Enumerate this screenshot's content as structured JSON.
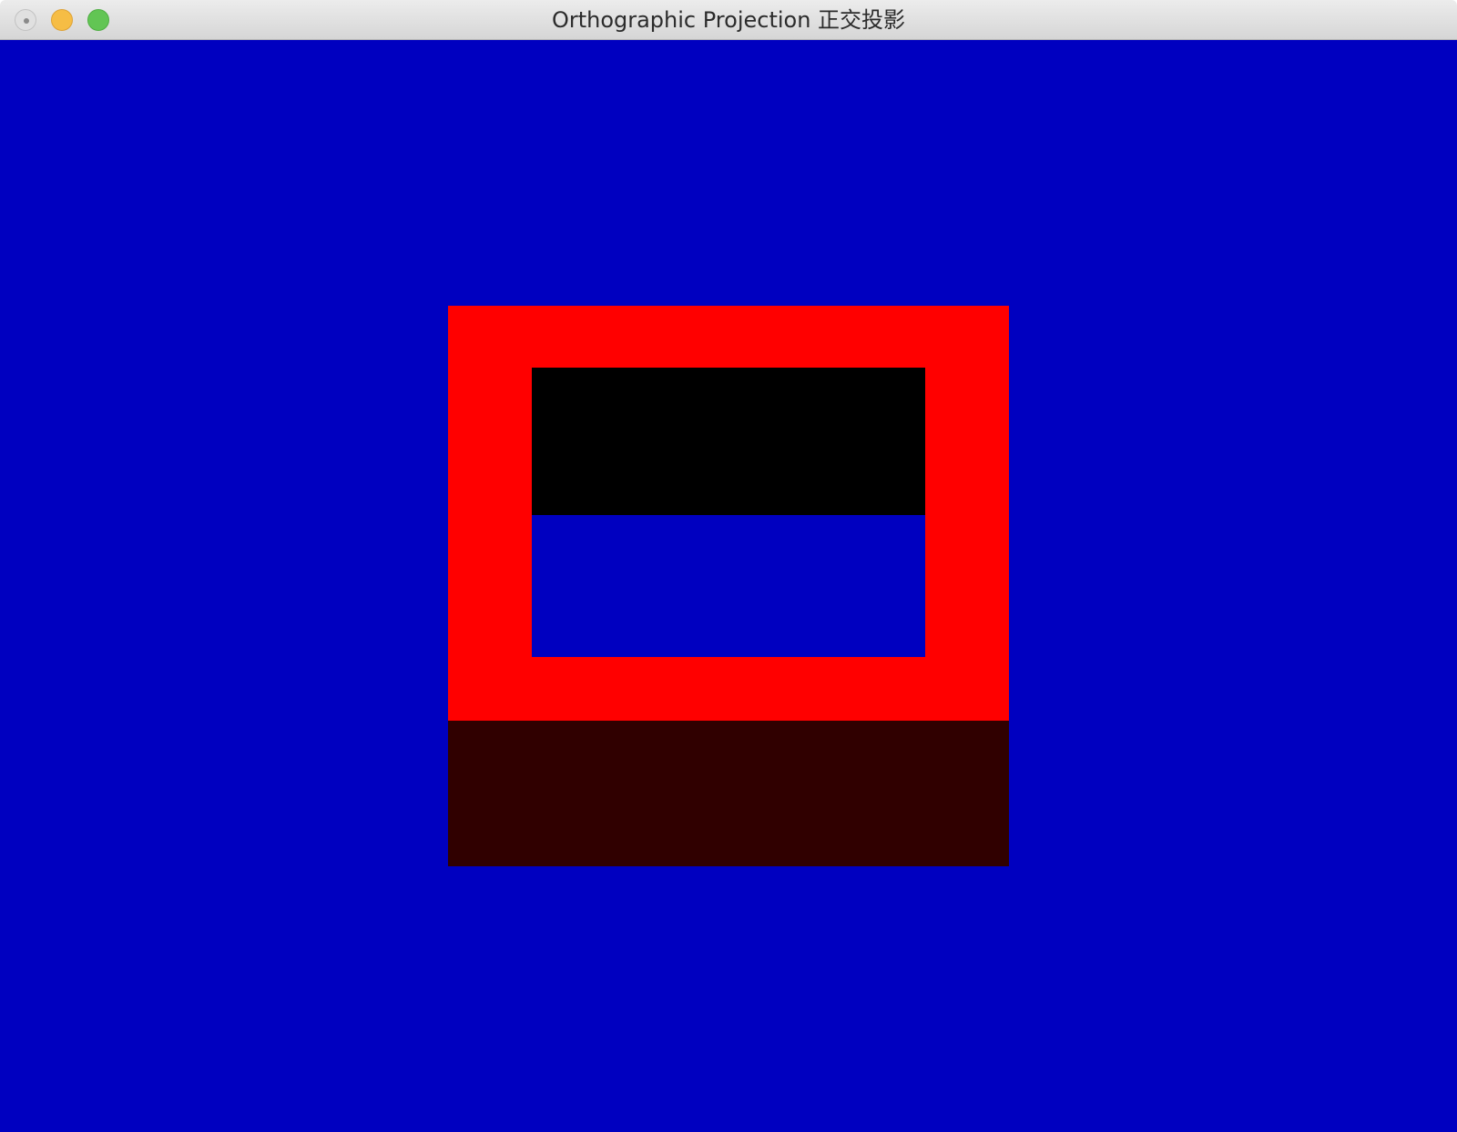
{
  "window": {
    "title": "Orthographic Projection 正交投影",
    "controls": [
      {
        "name": "close",
        "color": "#e0e0e0",
        "border": "#c2c2c2"
      },
      {
        "name": "minimize",
        "color": "#f6bd45",
        "border": "#dea236"
      },
      {
        "name": "zoom",
        "color": "#62c554",
        "border": "#4fae43"
      }
    ]
  },
  "scene": {
    "clear_color": "#0000c0",
    "shapes": [
      {
        "name": "outer-square",
        "color": "#ff0000"
      },
      {
        "name": "inner-top",
        "color": "#000000"
      },
      {
        "name": "inner-bottom",
        "color": "#0000c0"
      },
      {
        "name": "lower-band",
        "color": "#300000"
      }
    ]
  }
}
